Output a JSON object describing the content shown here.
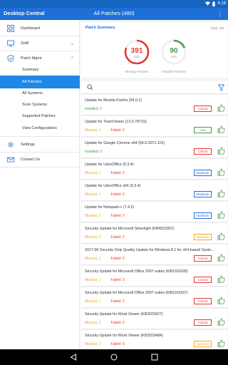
{
  "status": {
    "time": "4:18"
  },
  "app": {
    "title": "Desktop Central",
    "page_title": "All Patches (480)"
  },
  "sidebar": {
    "items": [
      {
        "label": "Dashboard",
        "icon": "dashboard-icon"
      },
      {
        "label": "SoM",
        "icon": "monitor-icon"
      },
      {
        "label": "Patch Mgmt",
        "icon": "shield-icon"
      },
      {
        "label": "Settings",
        "icon": "gear-icon"
      },
      {
        "label": "Contact Us",
        "icon": "mail-icon"
      }
    ],
    "sub_items": [
      {
        "label": "Summary"
      },
      {
        "label": "All Patches"
      },
      {
        "label": "All Systems"
      },
      {
        "label": "Scan Systems"
      },
      {
        "label": "Supported Patches"
      },
      {
        "label": "View Configurations"
      }
    ]
  },
  "summary": {
    "title": "Patch Summary",
    "total": "Total: 481",
    "missing": {
      "value": "391",
      "pct": "81%",
      "label": "Missing Patches",
      "fraction": 0.81,
      "color": "#e53935"
    },
    "installed": {
      "value": "90",
      "pct": "19%",
      "label": "Installed Patches",
      "fraction": 0.19,
      "color": "#43a047"
    }
  },
  "patches": [
    {
      "title": "Update for Mozilla Firefox (54.0.1)",
      "status": "installed",
      "label": "Installed:",
      "count": "2",
      "severity": "Critical"
    },
    {
      "title": "Update for TeamViewer (12.0.78716)",
      "status": "missing",
      "label": "Missing:",
      "count": "1",
      "failed_label": "Failed:",
      "failed": "0",
      "severity": "Low"
    },
    {
      "title": "Update for Google Chrome x64 (59.0.3071.115)",
      "status": "installed",
      "label": "Installed:",
      "count": "2",
      "severity": "Critical"
    },
    {
      "title": "Update for LibreOffice (5.3.4)",
      "status": "missing",
      "label": "Missing:",
      "count": "1",
      "failed_label": "Failed:",
      "failed": "0",
      "severity": "Moderate"
    },
    {
      "title": "Update for LibreOffice x64 (5.3.4)",
      "status": "missing",
      "label": "Missing:",
      "count": "1",
      "failed_label": "Failed:",
      "failed": "0",
      "severity": "Moderate"
    },
    {
      "title": "Update for Notepad++ (7.4.2)",
      "status": "missing",
      "label": "Missing:",
      "count": "2",
      "failed_label": "Failed:",
      "failed": "0",
      "severity": "Moderate"
    },
    {
      "title": "Security Update for Microsoft Silverlight (KB4023307)",
      "status": "missing",
      "label": "Missing:",
      "count": "2",
      "failed_label": "Failed:",
      "failed": "0",
      "severity": "Important"
    },
    {
      "title": "2017-06 Security Only Quality Update for Windows 8.1 for x64-based Syste...",
      "status": "missing",
      "label": "Missing:",
      "count": "1",
      "failed_label": "Failed:",
      "failed": "0",
      "severity": "Critical"
    },
    {
      "title": "Security Update for Microsoft Office 2007 suites (KB3191828)",
      "status": "missing",
      "label": "Missing:",
      "count": "1",
      "failed_label": "Failed:",
      "failed": "0",
      "severity": "Critical"
    },
    {
      "title": "Security Update for Microsoft Office 2007 suites (KB3191837)",
      "status": "missing",
      "label": "Missing:",
      "count": "1",
      "failed_label": "Failed:",
      "failed": "0",
      "severity": "Critical"
    },
    {
      "title": "Security Update for Word Viewer (KB3203427)",
      "status": "missing",
      "label": "Missing:",
      "count": "2",
      "failed_label": "Failed:",
      "failed": "0",
      "severity": "Critical"
    },
    {
      "title": "Security Update for Word Viewer (KB3203484)",
      "status": "missing",
      "label": "Missing:",
      "count": "2",
      "failed_label": "Failed:",
      "failed": "0",
      "severity": "Important"
    }
  ],
  "severity_colors": {
    "Critical": "#e53935",
    "Low": "#43a047",
    "Moderate": "#1e6fd6",
    "Important": "#f5a623"
  },
  "colors": {
    "accent": "#1e6fd6",
    "missing": "#f5a623",
    "installed": "#43a047",
    "failed": "#e53935"
  }
}
